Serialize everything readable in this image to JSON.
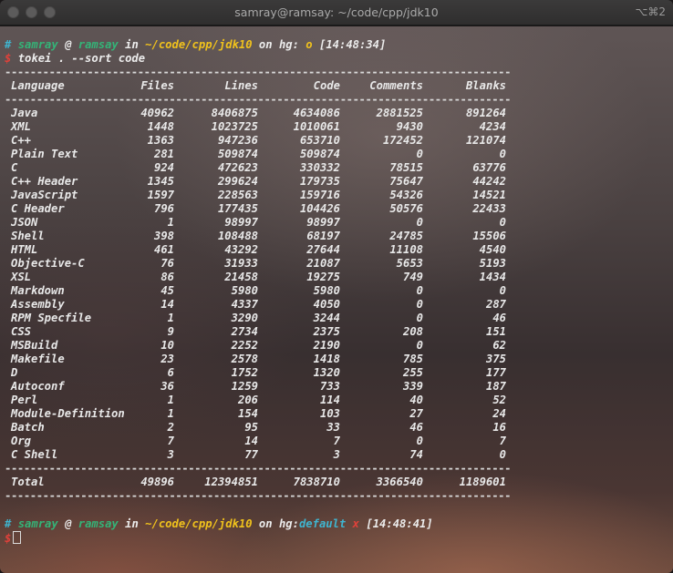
{
  "window": {
    "title": "samray@ramsay: ~/code/cpp/jdk10",
    "shortcut": "⌥⌘2"
  },
  "prompt1": {
    "hash": "#",
    "user": "samray",
    "at": "@",
    "host": "ramsay",
    "in": "in",
    "path": "~/code/cpp/jdk10",
    "on": "on",
    "vcs": "hg:",
    "branch": "o",
    "time": "[14:48:34]"
  },
  "command": {
    "dollar": "$",
    "text": "tokei . --sort code"
  },
  "separator": "--------------------------------------------------------------------------------",
  "table": {
    "headers": [
      "Language",
      "Files",
      "Lines",
      "Code",
      "Comments",
      "Blanks"
    ],
    "rows": [
      [
        "Java",
        "40962",
        "8406875",
        "4634086",
        "2881525",
        "891264"
      ],
      [
        "XML",
        "1448",
        "1023725",
        "1010061",
        "9430",
        "4234"
      ],
      [
        "C++",
        "1363",
        "947236",
        "653710",
        "172452",
        "121074"
      ],
      [
        "Plain Text",
        "281",
        "509874",
        "509874",
        "0",
        "0"
      ],
      [
        "C",
        "924",
        "472623",
        "330332",
        "78515",
        "63776"
      ],
      [
        "C++ Header",
        "1345",
        "299624",
        "179735",
        "75647",
        "44242"
      ],
      [
        "JavaScript",
        "1597",
        "228563",
        "159716",
        "54326",
        "14521"
      ],
      [
        "C Header",
        "796",
        "177435",
        "104426",
        "50576",
        "22433"
      ],
      [
        "JSON",
        "1",
        "98997",
        "98997",
        "0",
        "0"
      ],
      [
        "Shell",
        "398",
        "108488",
        "68197",
        "24785",
        "15506"
      ],
      [
        "HTML",
        "461",
        "43292",
        "27644",
        "11108",
        "4540"
      ],
      [
        "Objective-C",
        "76",
        "31933",
        "21087",
        "5653",
        "5193"
      ],
      [
        "XSL",
        "86",
        "21458",
        "19275",
        "749",
        "1434"
      ],
      [
        "Markdown",
        "45",
        "5980",
        "5980",
        "0",
        "0"
      ],
      [
        "Assembly",
        "14",
        "4337",
        "4050",
        "0",
        "287"
      ],
      [
        "RPM Specfile",
        "1",
        "3290",
        "3244",
        "0",
        "46"
      ],
      [
        "CSS",
        "9",
        "2734",
        "2375",
        "208",
        "151"
      ],
      [
        "MSBuild",
        "10",
        "2252",
        "2190",
        "0",
        "62"
      ],
      [
        "Makefile",
        "23",
        "2578",
        "1418",
        "785",
        "375"
      ],
      [
        "D",
        "6",
        "1752",
        "1320",
        "255",
        "177"
      ],
      [
        "Autoconf",
        "36",
        "1259",
        "733",
        "339",
        "187"
      ],
      [
        "Perl",
        "1",
        "206",
        "114",
        "40",
        "52"
      ],
      [
        "Module-Definition",
        "1",
        "154",
        "103",
        "27",
        "24"
      ],
      [
        "Batch",
        "2",
        "95",
        "33",
        "46",
        "16"
      ],
      [
        "Org",
        "7",
        "14",
        "7",
        "0",
        "7"
      ],
      [
        "C Shell",
        "3",
        "77",
        "3",
        "74",
        "0"
      ]
    ],
    "total": [
      "Total",
      "49896",
      "12394851",
      "7838710",
      "3366540",
      "1189601"
    ]
  },
  "prompt2": {
    "hash": "#",
    "user": "samray",
    "at": "@",
    "host": "ramsay",
    "in": "in",
    "path": "~/code/cpp/jdk10",
    "on": "on",
    "vcs": "hg:",
    "branch": "default",
    "mark": "x",
    "time": "[14:48:41]"
  },
  "input": {
    "dollar": "$",
    "text": ""
  },
  "colors": {
    "prompt_user": "#34b478",
    "prompt_path": "#f0c21c",
    "prompt_error": "#e0413a",
    "prompt_branch": "#3fb5d0"
  }
}
